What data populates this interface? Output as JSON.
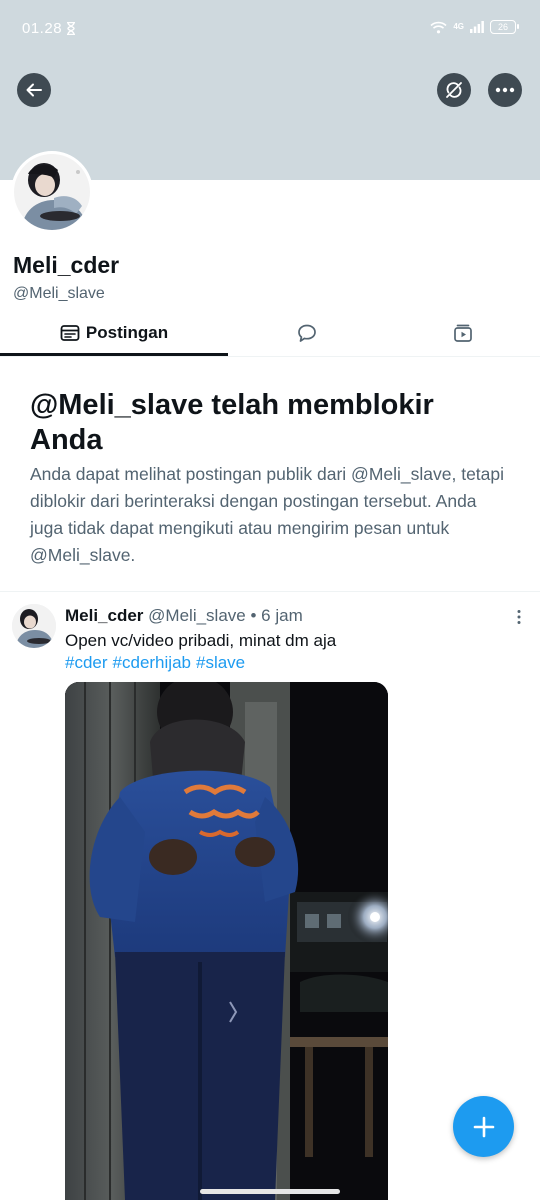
{
  "status_bar": {
    "time": "01.28",
    "network": "4G",
    "battery": "26"
  },
  "profile": {
    "display_name": "Meli_cder",
    "handle": "@Meli_slave"
  },
  "tabs": [
    {
      "label": "Postingan",
      "icon": "posts-icon",
      "active": true
    },
    {
      "label": "",
      "icon": "replies-icon",
      "active": false
    },
    {
      "label": "",
      "icon": "media-icon",
      "active": false
    }
  ],
  "blocked_notice": {
    "title": "@Meli_slave telah memblokir Anda",
    "body": "Anda dapat melihat postingan publik dari @Meli_slave, tetapi diblokir dari berinteraksi dengan postingan tersebut. Anda juga tidak dapat mengikuti atau mengirim pesan untuk @Meli_slave."
  },
  "tweet": {
    "name": "Meli_cder",
    "handle": "@Meli_slave",
    "separator": "•",
    "time": "6 jam",
    "text": "Open vc/video pribadi, minat dm aja",
    "hashtags": [
      "#cder",
      "#cderhijab",
      "#slave"
    ]
  },
  "colors": {
    "banner": "#cfd9de",
    "accent": "#1d9bf0",
    "text_primary": "#0f1419",
    "text_secondary": "#536471"
  }
}
